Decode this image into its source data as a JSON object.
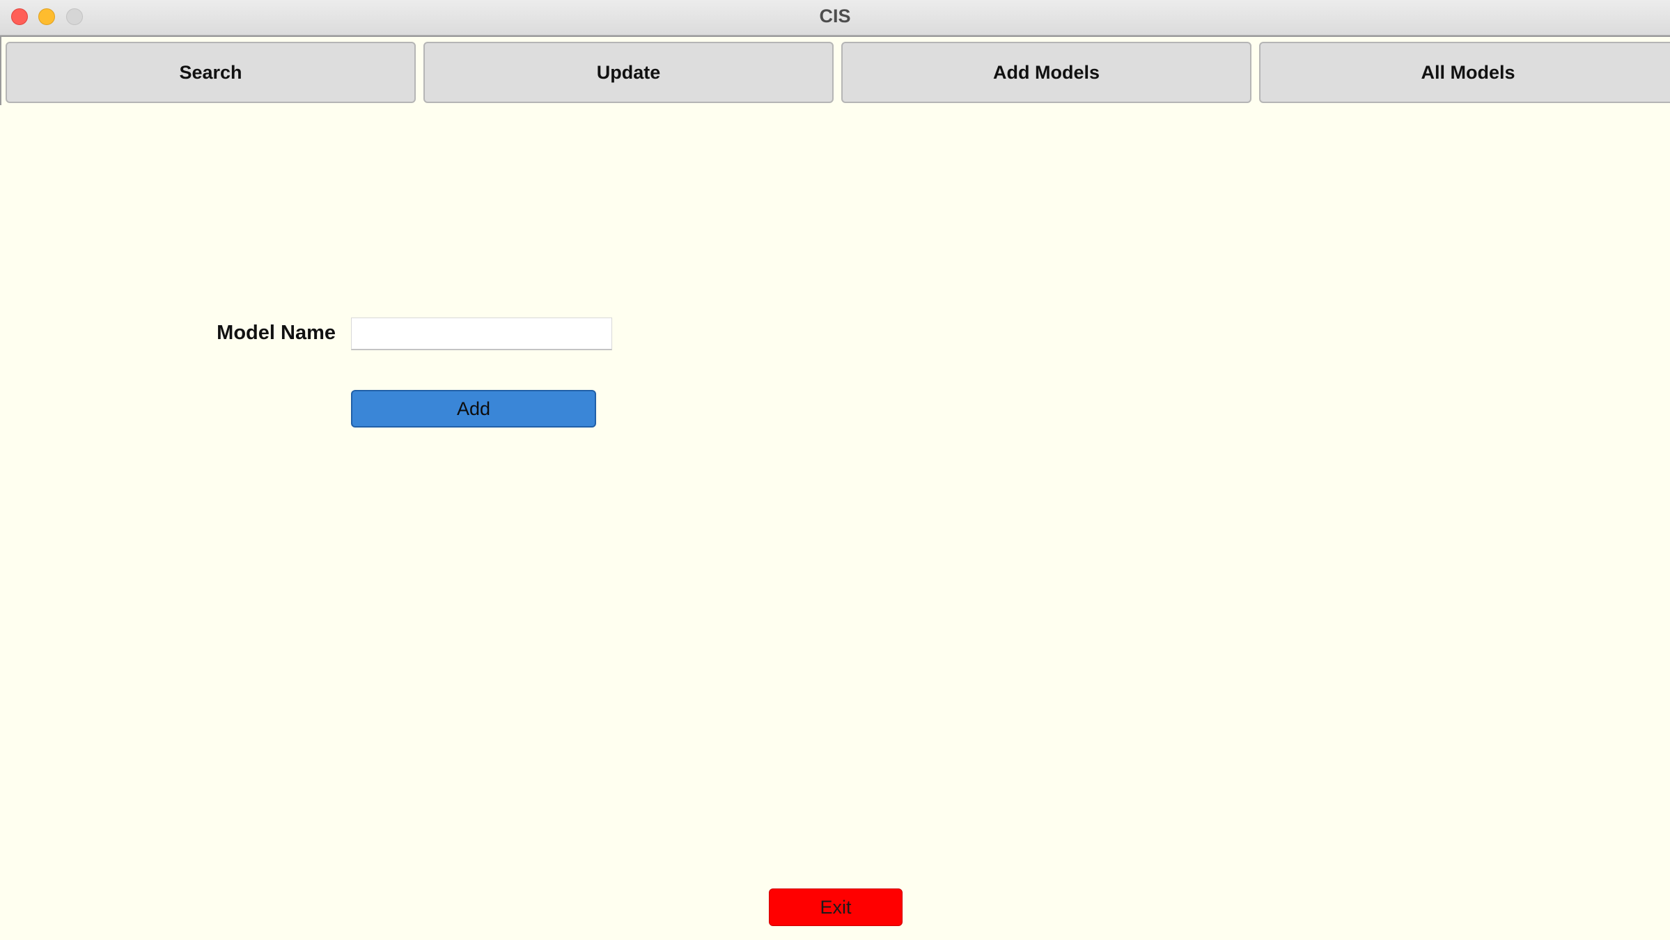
{
  "window": {
    "title": "CIS"
  },
  "tabs": [
    {
      "label": "Search"
    },
    {
      "label": "Update"
    },
    {
      "label": "Add Models"
    },
    {
      "label": "All Models"
    }
  ],
  "form": {
    "model_name_label": "Model Name",
    "model_name_value": "",
    "model_name_placeholder": "",
    "add_label": "Add"
  },
  "footer": {
    "exit_label": "Exit"
  },
  "colors": {
    "background": "#fffff0",
    "tab_background": "#dddddd",
    "add_button": "#3a86d7",
    "exit_button": "#ff0000",
    "close_light": "#ff5f57",
    "minimize_light": "#febc2e",
    "zoom_light_disabled": "#d6d6d6"
  }
}
